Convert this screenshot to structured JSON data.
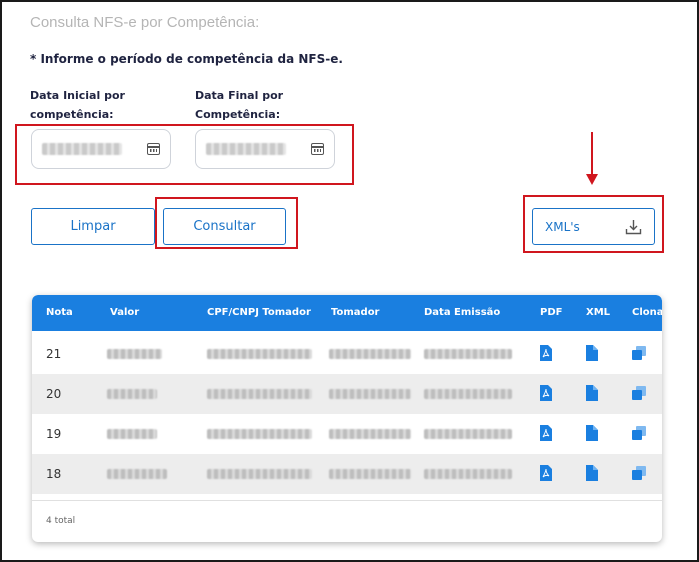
{
  "page": {
    "title": "Consulta NFS-e por Competência:",
    "hint": "* Informe o período de competência da NFS-e."
  },
  "filters": {
    "start_label_line1": "Data Inicial por",
    "start_label_line2": "competência:",
    "end_label_line1": "Data Final por",
    "end_label_line2": "Competência:"
  },
  "actions": {
    "clear_label": "Limpar",
    "search_label": "Consultar",
    "xml_label": "XML's"
  },
  "table": {
    "columns": [
      "Nota",
      "Valor",
      "CPF/CNPJ Tomador",
      "Tomador",
      "Data Emissão",
      "PDF",
      "XML",
      "Clonar"
    ],
    "rows": [
      {
        "nota": "21"
      },
      {
        "nota": "20"
      },
      {
        "nota": "19"
      },
      {
        "nota": "18"
      }
    ],
    "total_text": "4 total"
  },
  "icons": {
    "calendar": "calendar-icon",
    "download": "download-icon",
    "pdf": "pdf-file-icon",
    "xml": "xml-file-icon",
    "clone": "clone-icon"
  },
  "colors": {
    "primary": "#1a7fe0",
    "button_text": "#1a73c7",
    "highlight": "#d0161e",
    "title_gray": "#b5b5b5"
  }
}
